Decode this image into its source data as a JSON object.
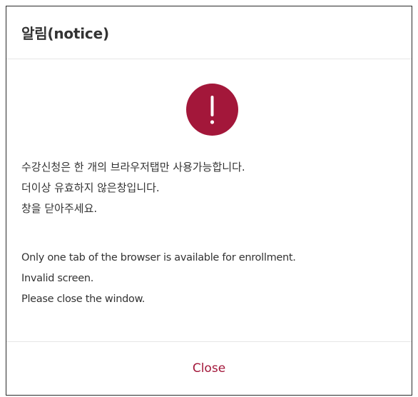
{
  "dialog": {
    "title": "알림(notice)",
    "icon": "exclamation-icon",
    "icon_color": "#a3173a",
    "message_ko": [
      "수강신청은 한 개의 브라우저탭만 사용가능합니다.",
      "더이상 유효하지 않은창입니다.",
      "창을 닫아주세요."
    ],
    "message_en": [
      "Only one tab of the browser is available for enrollment.",
      "Invalid screen.",
      "Please close the window."
    ],
    "close_label": "Close",
    "accent_color": "#a3173a"
  }
}
